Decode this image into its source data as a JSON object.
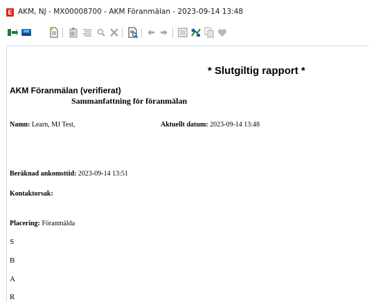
{
  "window": {
    "title": "AKM, NJ - MX00008700  - AKM Föranmälan - 2023-09-14 13:48",
    "app_icon_letter": "E"
  },
  "toolbar": {
    "icons": [
      "insert-icon",
      "save-icon",
      "new-document-icon",
      "paste-icon",
      "align-icon",
      "zoom-icon",
      "delete-icon",
      "print-preview-icon",
      "back-arrow-icon",
      "forward-arrow-icon",
      "image-icon",
      "sign-icon",
      "copy-icon",
      "heart-icon"
    ]
  },
  "report": {
    "banner": "* Slutgiltig rapport *",
    "title": "AKM Föranmälan (verifierat)",
    "subtitle": "Sammanfattning för föranmälan",
    "name_label": "Namn:",
    "name_value": "Learn, MJ Test,",
    "date_label": "Aktuellt datum:",
    "date_value": "2023-09-14 13:48",
    "eta_label": "Beräknad ankomsttid:",
    "eta_value": "2023-09-14 13:51",
    "contact_label": "Kontaktorsak:",
    "contact_value": "",
    "placement_label": "Placering:",
    "placement_value": "Föranmälda",
    "sbar": [
      "S",
      "B",
      "A",
      "R"
    ]
  },
  "colors": {
    "app_icon": "#d9261c",
    "border": "#c7ddee"
  }
}
